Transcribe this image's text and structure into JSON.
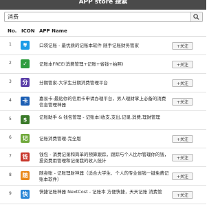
{
  "header": {
    "title": "APP store 搜索"
  },
  "search": {
    "value": "消费",
    "placeholder": ""
  },
  "columns": {
    "no": "No.",
    "icon": "ICON",
    "name": "APP Name"
  },
  "follow_label": "+关注",
  "apps": [
    {
      "no": "1",
      "name": "口袋记账 - 最优质的记账本软件 随手记账财务管家",
      "icon": "wallet-app-icon",
      "color": "#1a9be6",
      "glyph": "¥",
      "has_follow": true
    },
    {
      "no": "2",
      "name": "记账本FREE(消费管理+记账+省钱+拍照)",
      "icon": "notebook-app-icon",
      "color": "#2e9c3e",
      "glyph": "✓",
      "has_follow": true
    },
    {
      "no": "3",
      "name": "分期管家-大学生分期消费管理平台",
      "icon": "installment-app-icon",
      "color": "#5b3fa8",
      "glyph": "分",
      "has_follow": true
    },
    {
      "no": "4",
      "name": "嘉易卡-最贴你的信用卡申请办理平台，男人理财掌上必备的消费信息管理神器",
      "icon": "credit-card-app-icon",
      "color": "#1c5fb4",
      "glyph": "卡",
      "has_follow": true
    },
    {
      "no": "5",
      "name": "记账助手 & 钱包管理 - 记账本)收支,支出,记录,消费,理财管理",
      "icon": "coin-app-icon",
      "color": "#3b7a2a",
      "glyph": "$",
      "has_follow": false
    },
    {
      "no": "6",
      "name": "记账消费管理-完全版",
      "icon": "leaf-app-icon",
      "color": "#6fa83a",
      "glyph": "记",
      "has_follow": true
    },
    {
      "no": "7",
      "name": "钱包 - 消费记录和简单的预算跟踪，跟踪与个人比尔管理你的钱，投资费用管理和记录我的收入统计",
      "icon": "wallet-red-app-icon",
      "color": "#c8362b",
      "glyph": "钱",
      "has_follow": true
    },
    {
      "no": "8",
      "name": "随身账 - 记账理财神器（适合大学生、个人的专业省钱一键免费记账本软件）",
      "icon": "account-app-icon",
      "color": "#e98a1c",
      "glyph": "随",
      "has_follow": true
    },
    {
      "no": "9",
      "name": "快捷记账神器 NextCost - 记账本 方便快捷，天天记账 消费管",
      "icon": "fast-app-icon",
      "color": "#2a86d6",
      "glyph": "快",
      "has_follow": true
    }
  ]
}
